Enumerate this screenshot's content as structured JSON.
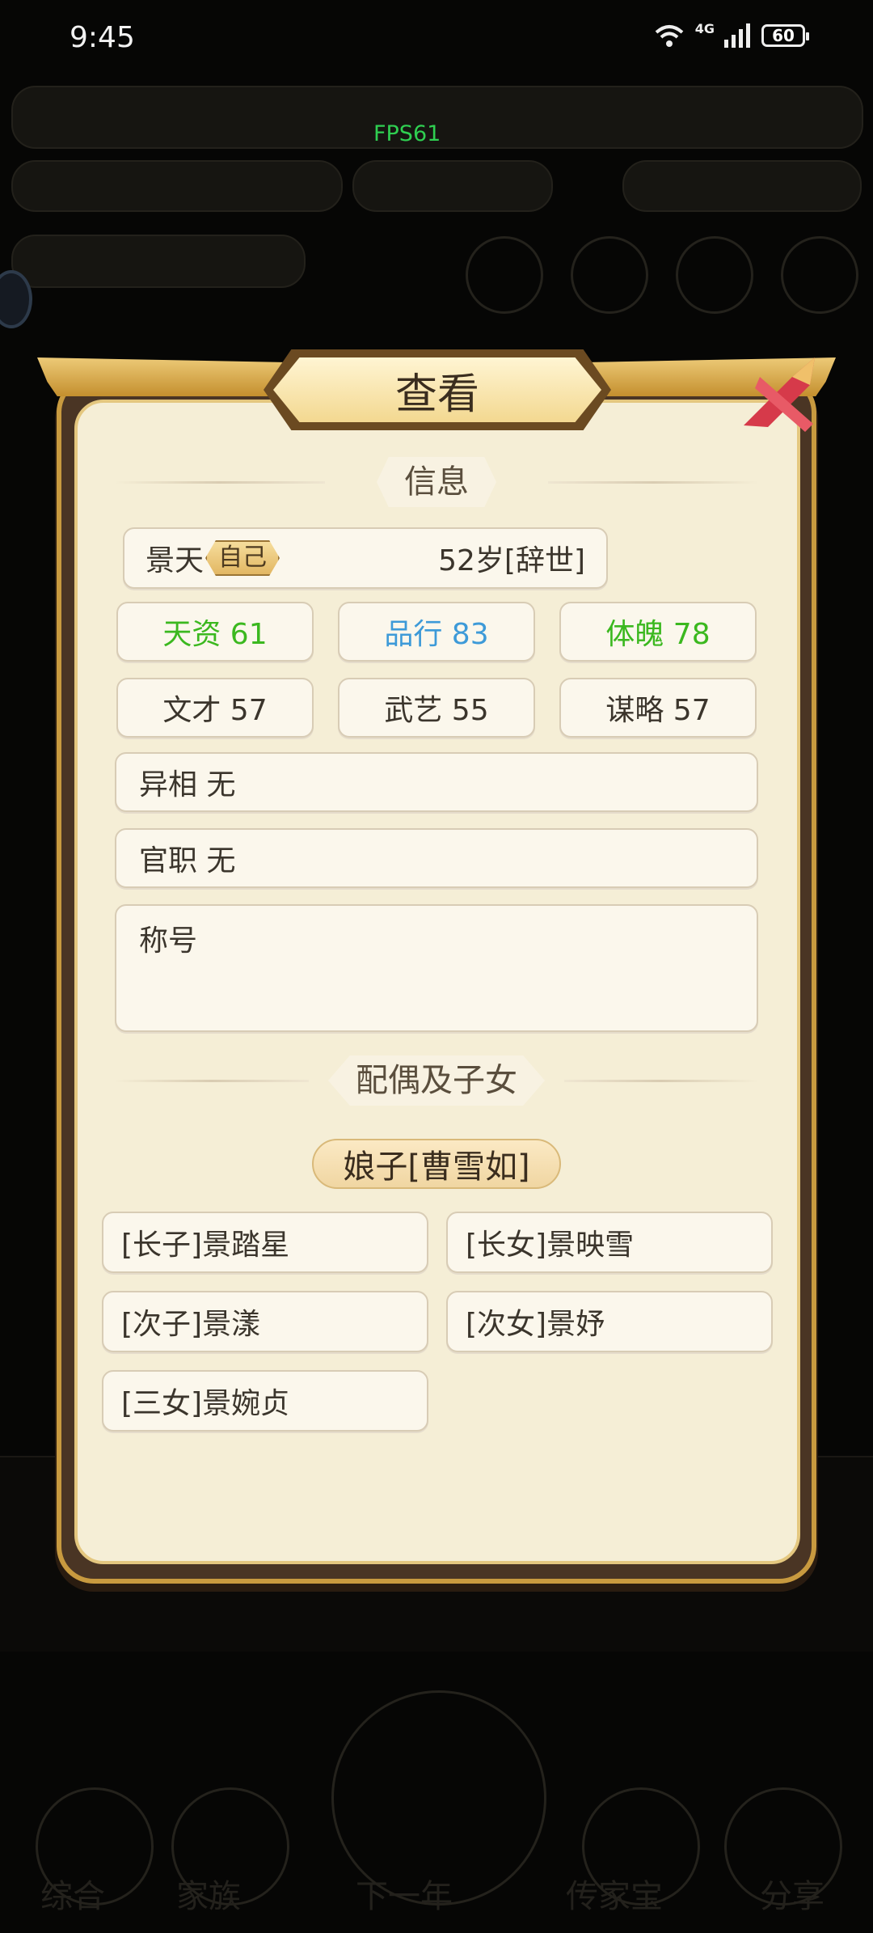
{
  "status_bar": {
    "time": "9:45",
    "network": "4G",
    "battery": "60"
  },
  "fps_label": "FPS61",
  "background": {
    "bottom_nav": [
      "综合",
      "家族",
      "下一年",
      "传家宝",
      "分享"
    ]
  },
  "dialog": {
    "title": "查看",
    "info_section": "信息",
    "person": {
      "name": "景天",
      "self_tag": "自己",
      "age_status": "52岁[辞世]"
    },
    "stats": [
      {
        "label": "天资 61",
        "color": "#3bb81f"
      },
      {
        "label": "品行 83",
        "color": "#3d9ad8"
      },
      {
        "label": "体魄 78",
        "color": "#3bb81f"
      },
      {
        "label": "文才 57",
        "color": "#3b352c"
      },
      {
        "label": "武艺 55",
        "color": "#3b352c"
      },
      {
        "label": "谋略 57",
        "color": "#3b352c"
      }
    ],
    "trait": "异相 无",
    "office": "官职 无",
    "title_label": "称号",
    "family_section": "配偶及子女",
    "spouse": "娘子[曹雪如]",
    "children": [
      "[长子]景踏星",
      "[长女]景映雪",
      "[次子]景漾",
      "[次女]景妤",
      "[三女]景婉贞"
    ]
  }
}
